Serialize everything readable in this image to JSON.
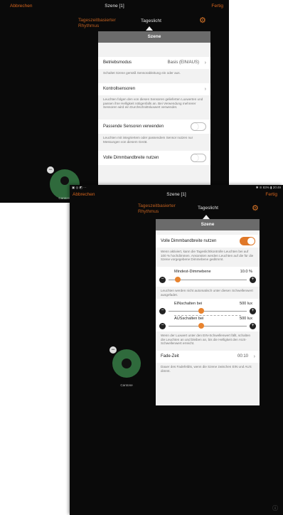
{
  "screen1": {
    "header": {
      "cancel": "Abbrechen",
      "title": "Szene [1]",
      "done": "Fertig"
    },
    "mode_tabs": {
      "rhythm_line1": "Tageszeitbasierter",
      "rhythm_line2": "Rhythmus",
      "daylight": "Tageslicht"
    },
    "panel": {
      "title": "Szene",
      "operating_mode": {
        "label": "Betriebsmodus",
        "value": "Basis (EIN/AUS)"
      },
      "operating_mode_desc": "Schaltet Szene gemäß Sensorableitung ein oder aus.",
      "control_sensors": {
        "label": "Kontrollsensoren"
      },
      "control_sensors_desc": "Leuchten folgen den von diesen Sensoren gelieferten Luxwerten und passen ihre Helligkeit nötigenfalls an. Bei Verwendung mehrerer Sensoren wird ein Durchschnittsluxwert verwendet.",
      "matching_sensors": {
        "label": "Passende Sensoren verwenden"
      },
      "matching_sensors_desc": "Leuchten mit integriertem oder passendem Sensor nutzen nur Messungen von diesem Gerät.",
      "full_dim": {
        "label": "Volle Dimmbandbreite nutzen"
      }
    },
    "device_label": "Cantone"
  },
  "screen2": {
    "status_left": "▣ ◎ ◩ ···",
    "status_right": "✱ ≋ 83% ▮ 20:49",
    "header": {
      "cancel": "Abbrechen",
      "title": "Szene [1]",
      "done": "Fertig"
    },
    "mode_tabs": {
      "rhythm_line1": "Tageszeitbasierter",
      "rhythm_line2": "Rhythmus",
      "daylight": "Tageslicht"
    },
    "panel": {
      "title": "Szene",
      "full_dim": {
        "label": "Volle Dimmbandbreite nutzen",
        "on": true
      },
      "full_dim_desc": "Wenn aktiviert, kann die Tageslichtkontrolle Leuchten bei auf 100 % hochdimmen. Ansonsten werden Leuchten auf die für die Szene vorgegebene Dimmebene geditmmt.",
      "min_dim": {
        "label": "Mindest-Dimmebene",
        "value": "10.0 %",
        "level": 0.12
      },
      "min_dim_desc": "Leuchten werden nicht automatisch unter diesen Schwellenwert ausgefadet.",
      "switch_on": {
        "label": "EINschalten bei",
        "value": "500 lux",
        "level": 0.42
      },
      "switch_off": {
        "label": "AUSschalten bei",
        "value": "500 lux",
        "level": 0.42
      },
      "switch_desc": "Wenn der Luxwert unter den EIN-Schwellenwert fällt, schalten die Leuchten an und bleiben an, bis die Helligkeit den AUS-Schwellenwert erreicht.",
      "fade": {
        "label": "Fade-Zeit",
        "value": "00:10"
      },
      "fade_desc": "Dauer des Fadefeldts, wenn die Szene zwischen EIN und AUS dimmt."
    },
    "device_label": "Cantone",
    "info_icon_glyph": "ⓘ"
  }
}
